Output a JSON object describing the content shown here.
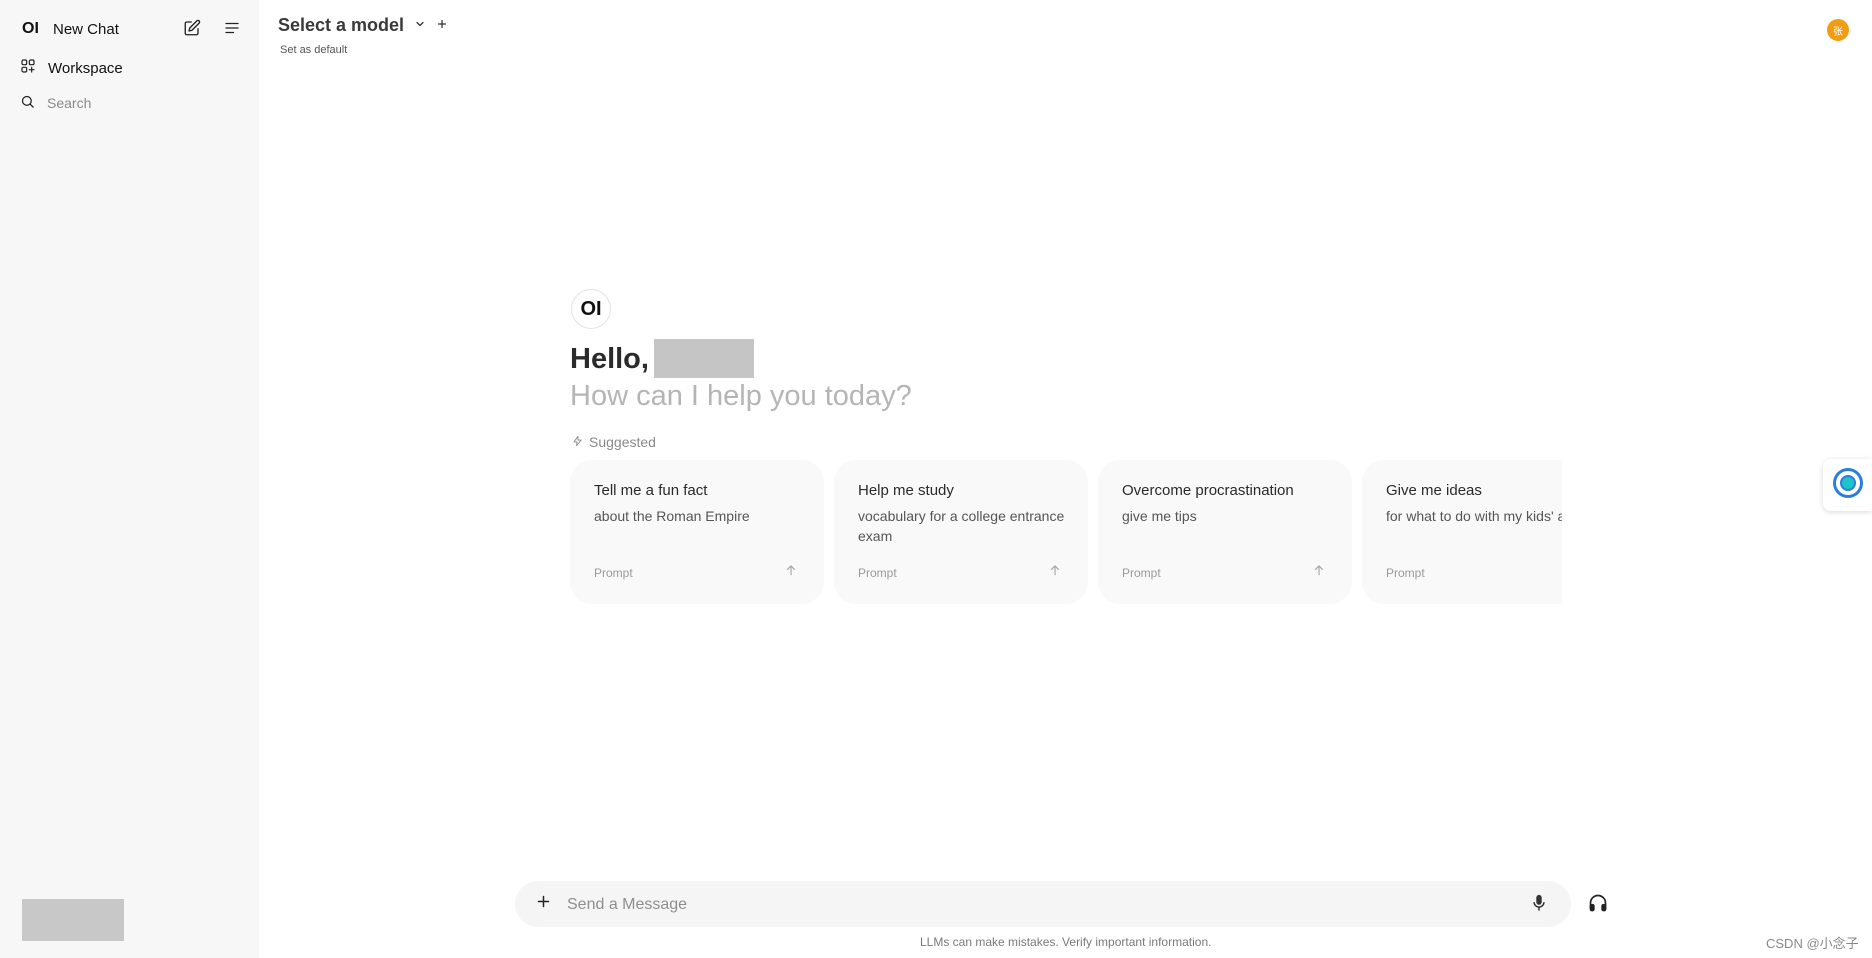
{
  "sidebar": {
    "logo": "OI",
    "new_chat_label": "New Chat",
    "workspace_label": "Workspace",
    "search_placeholder": "Search"
  },
  "header": {
    "model_title": "Select a model",
    "set_default": "Set as default",
    "avatar_initial": "张"
  },
  "main": {
    "brand": "OI",
    "greeting": "Hello,",
    "subtitle": "How can I help you today?",
    "suggested_label": "Suggested",
    "cards": [
      {
        "title": "Tell me a fun fact",
        "subtitle": "about the Roman Empire",
        "prompt": "Prompt"
      },
      {
        "title": "Help me study",
        "subtitle": "vocabulary for a college entrance exam",
        "prompt": "Prompt"
      },
      {
        "title": "Overcome procrastination",
        "subtitle": "give me tips",
        "prompt": "Prompt"
      },
      {
        "title": "Give me ideas",
        "subtitle": "for what to do with my kids' art",
        "prompt": "Prompt"
      }
    ]
  },
  "composer": {
    "placeholder": "Send a Message",
    "disclaimer": "LLMs can make mistakes. Verify important information."
  },
  "watermark": "CSDN @小念子",
  "colors": {
    "sidebar_bg": "#f7f7f7",
    "avatar": "#f39c12",
    "card_bg": "#f9f9f9"
  }
}
